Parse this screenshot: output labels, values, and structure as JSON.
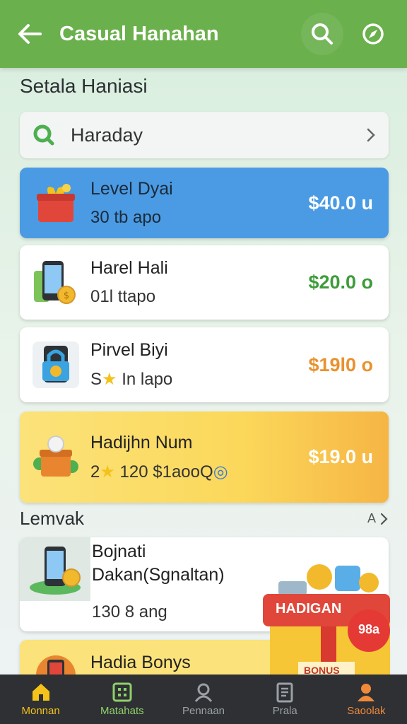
{
  "header": {
    "title": "Casual Hanahan"
  },
  "section": {
    "title": "Setala Haniasi"
  },
  "search_row": {
    "label": "Haraday"
  },
  "offers": [
    {
      "name": "Level Dyai",
      "sub": "30 tb apo",
      "price": "$40.0 u"
    },
    {
      "name": "Harel Hali",
      "sub": "01l ttapo",
      "price": "$20.0 o"
    },
    {
      "name": "Pirvel Biyi",
      "sub_prefix": "S",
      "sub_suffix": "In lapo",
      "price": "$19l0 o"
    },
    {
      "name": "Hadijhn Num",
      "sub_prefix": "2",
      "sub_suffix": "120 $1aooQ",
      "price": "$19.0 u"
    }
  ],
  "more_section": {
    "label": "Lemvak",
    "more_label": "A"
  },
  "bonus_card": {
    "name": "Bojnati",
    "desc": "Dakan(Sgnaltan)",
    "sub": "130 8 ang"
  },
  "bonus_card2": {
    "name": "Hadia Bonys"
  },
  "promo": {
    "banner": "HADIGAN",
    "badge": "98a",
    "box_label": "BONUS"
  },
  "nav": [
    {
      "label": "Monnan"
    },
    {
      "label": "Matahats"
    },
    {
      "label": "Pennaan"
    },
    {
      "label": "Prala"
    },
    {
      "label": "Saoolak"
    }
  ],
  "colors": {
    "header": "#6ab04c",
    "card_blue": "#4a9be3",
    "card_yellow": "#fbd85a",
    "nav_bg": "#2e3033",
    "active": "#f4c21b"
  }
}
